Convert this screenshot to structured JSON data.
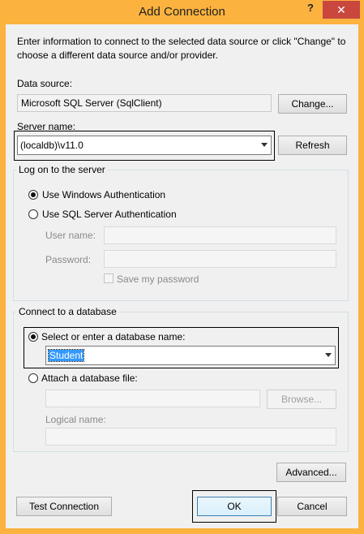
{
  "window": {
    "title": "Add Connection",
    "help_glyph": "?",
    "close_glyph": "✕"
  },
  "intro": {
    "line1": "Enter information to connect to the selected data source or click \"Change\" to",
    "line2": "choose a different data source and/or provider."
  },
  "data_source": {
    "label": "Data source:",
    "value": "Microsoft SQL Server (SqlClient)",
    "change_label": "Change..."
  },
  "server": {
    "label": "Server name:",
    "value": "(localdb)\\v11.0",
    "refresh_label": "Refresh"
  },
  "logon": {
    "legend": "Log on to the server",
    "windows_auth_label": "Use Windows Authentication",
    "sql_auth_label": "Use SQL Server Authentication",
    "selected": "windows",
    "user_name_label": "User name:",
    "user_name_value": "",
    "password_label": "Password:",
    "password_value": "",
    "save_password_label": "Save my password",
    "save_password_checked": false
  },
  "database": {
    "legend": "Connect to a database",
    "select_label": "Select or enter a database name:",
    "select_value": "Student",
    "attach_label": "Attach a database file:",
    "attach_value": "",
    "browse_label": "Browse...",
    "logical_name_label": "Logical name:",
    "logical_name_value": "",
    "selected": "select"
  },
  "buttons": {
    "advanced": "Advanced...",
    "test": "Test Connection",
    "ok": "OK",
    "cancel": "Cancel"
  },
  "colors": {
    "frame": "#fbb23f",
    "close": "#c9473d",
    "dialog": "#f0f0f0",
    "selection": "#3399ff"
  }
}
